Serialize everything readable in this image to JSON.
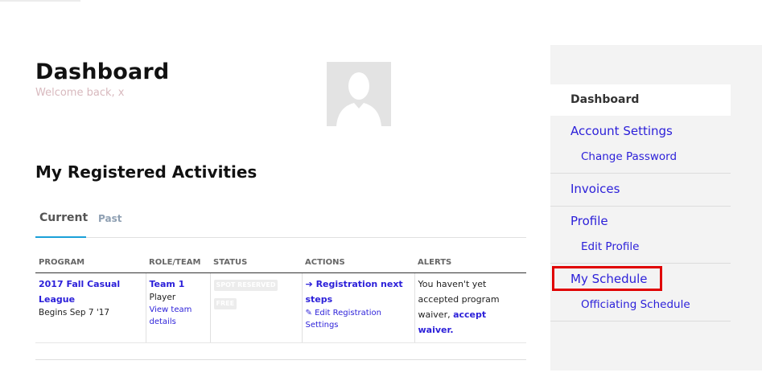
{
  "header": {
    "title": "Dashboard",
    "welcome": "Welcome back, x"
  },
  "section": {
    "title": "My Registered Activities"
  },
  "tabs": [
    {
      "label": "Current",
      "active": true
    },
    {
      "label": "Past",
      "active": false
    }
  ],
  "table": {
    "columns": [
      "PROGRAM",
      "ROLE/TEAM",
      "STATUS",
      "ACTIONS",
      "ALERTS"
    ],
    "rows": [
      {
        "program_name": "2017 Fall Casual League",
        "program_begins": "Begins Sep 7 '17",
        "team_name": "Team 1",
        "role": "Player",
        "view_team": "View team details",
        "status_badges": [
          "SPOT RESERVED",
          "FREE"
        ],
        "action_next": "Registration next steps",
        "action_edit": "Edit Registration Settings",
        "alert_text": "You haven't yet accepted program waiver,",
        "alert_link": "accept waiver."
      }
    ]
  },
  "sidebar": {
    "items": [
      {
        "label": "Dashboard",
        "active": true
      },
      {
        "label": "Account Settings"
      },
      {
        "label": "Change Password"
      },
      {
        "label": "Invoices"
      },
      {
        "label": "Profile"
      },
      {
        "label": "Edit Profile"
      },
      {
        "label": "My Schedule",
        "highlighted": true
      },
      {
        "label": "Officiating Schedule"
      }
    ]
  },
  "colors": {
    "link": "#2b1fd9",
    "tab_accent": "#1aa0d8",
    "highlight": "#e00000",
    "welcome": "#d8b9be"
  },
  "icons": [
    "avatar-placeholder-icon",
    "arrow-right-icon",
    "edit-icon"
  ]
}
